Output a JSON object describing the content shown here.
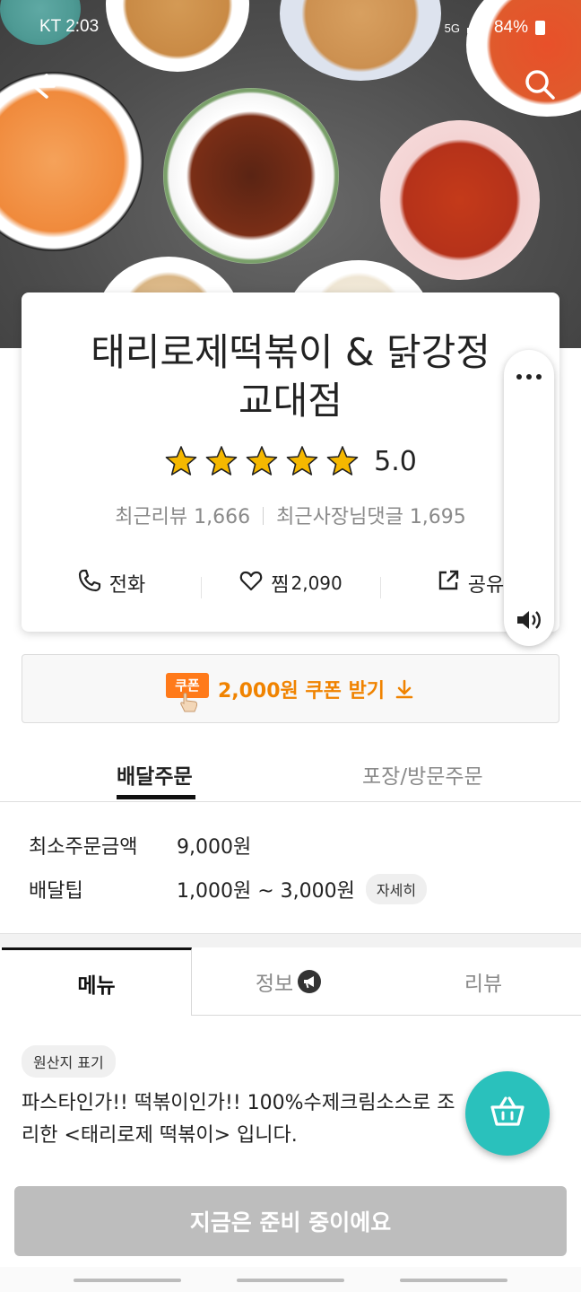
{
  "status_bar": {
    "time": "KT 2:03",
    "network": "5G",
    "battery": "84%"
  },
  "store": {
    "name_line1": "태리로제떡볶이 & 닭강정",
    "name_line2": "교대점",
    "rating": "5.0",
    "star_count": 5,
    "recent_reviews": "최근리뷰 1,666",
    "owner_replies": "최근사장님댓글 1,695"
  },
  "actions": {
    "call_label": "전화",
    "favorite_label": "찜",
    "favorite_count": "2,090",
    "share_label": "공유"
  },
  "coupon": {
    "badge": "쿠폰",
    "text": "2,000원 쿠폰 받기"
  },
  "order_tabs": [
    {
      "label": "배달주문",
      "active": true
    },
    {
      "label": "포장/방문주문",
      "active": false
    }
  ],
  "delivery_info": {
    "min_order_label": "최소주문금액",
    "min_order_value": "9,000원",
    "tip_label": "배달팁",
    "tip_value": "1,000원 ~ 3,000원",
    "detail_button": "자세히"
  },
  "content_tabs": [
    {
      "label": "메뉴",
      "active": true
    },
    {
      "label": "정보",
      "active": false
    },
    {
      "label": "리뷰",
      "active": false
    }
  ],
  "menu_section": {
    "origin_chip": "원산지 표기",
    "description": "파스타인가!! 떡볶이인가!! 100%수제크림소스로 조리한 <태리로제 떡볶이> 입니다."
  },
  "footer_button": "지금은 준비 중이에요",
  "colors": {
    "accent_mint": "#2ac1bc",
    "coupon_orange": "#f08300",
    "disabled_gray": "#bdbdbd",
    "star_gold": "#f5b800"
  },
  "icons": [
    "back-arrow-icon",
    "search-icon",
    "phone-icon",
    "heart-icon",
    "share-icon",
    "more-icon",
    "speaker-icon",
    "download-arrow-icon",
    "megaphone-icon",
    "basket-icon"
  ]
}
